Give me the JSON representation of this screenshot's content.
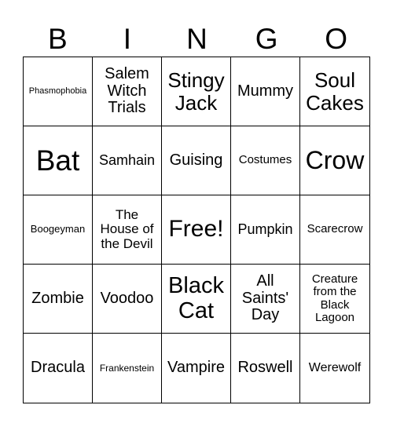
{
  "header": [
    "B",
    "I",
    "N",
    "G",
    "O"
  ],
  "cells": [
    {
      "text": "Phasmophobia",
      "size": 11
    },
    {
      "text": "Salem Witch Trials",
      "size": 20
    },
    {
      "text": "Stingy Jack",
      "size": 26
    },
    {
      "text": "Mummy",
      "size": 20
    },
    {
      "text": "Soul Cakes",
      "size": 26
    },
    {
      "text": "Bat",
      "size": 37
    },
    {
      "text": "Samhain",
      "size": 18
    },
    {
      "text": "Guising",
      "size": 20
    },
    {
      "text": "Costumes",
      "size": 15
    },
    {
      "text": "Crow",
      "size": 32
    },
    {
      "text": "Boogeyman",
      "size": 13
    },
    {
      "text": "The House of the Devil",
      "size": 17
    },
    {
      "text": "Free!",
      "size": 30
    },
    {
      "text": "Pumpkin",
      "size": 18
    },
    {
      "text": "Scarecrow",
      "size": 15
    },
    {
      "text": "Zombie",
      "size": 20
    },
    {
      "text": "Voodoo",
      "size": 20
    },
    {
      "text": "Black Cat",
      "size": 29
    },
    {
      "text": "All Saints' Day",
      "size": 20
    },
    {
      "text": "Creature from the Black Lagoon",
      "size": 15
    },
    {
      "text": "Dracula",
      "size": 20
    },
    {
      "text": "Frankenstein",
      "size": 12
    },
    {
      "text": "Vampire",
      "size": 20
    },
    {
      "text": "Roswell",
      "size": 20
    },
    {
      "text": "Werewolf",
      "size": 16
    }
  ]
}
